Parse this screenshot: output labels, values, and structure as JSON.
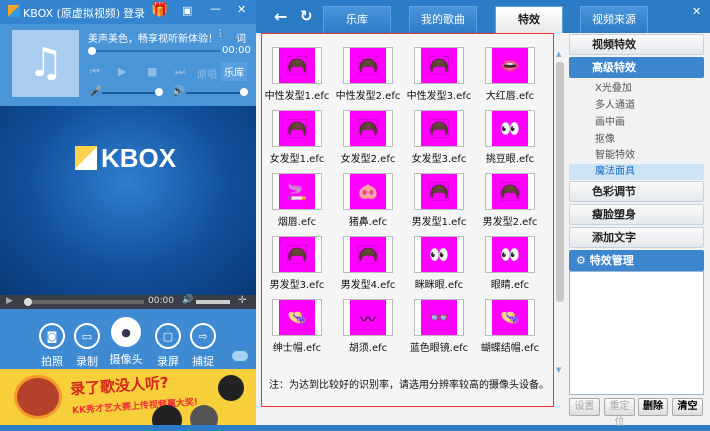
{
  "app": {
    "title": "KBOX (原虚拟视频)",
    "login": "登录",
    "logo": "KBOX"
  },
  "player": {
    "song_text": "美声美色，畅享视听新体验！",
    "lyrics_label": "词",
    "time": "00:00",
    "original_vocal": "原唱",
    "library": "乐库"
  },
  "video": {
    "time": "00:00"
  },
  "controls": [
    {
      "label": "拍照",
      "icon": "camera-icon"
    },
    {
      "label": "录制",
      "icon": "video-record-icon"
    },
    {
      "label": "摄像头",
      "icon": "webcam-icon"
    },
    {
      "label": "录屏",
      "icon": "screen-record-icon"
    },
    {
      "label": "捕捉",
      "icon": "capture-icon"
    }
  ],
  "banner": {
    "headline": "录了歌没人听?",
    "subline": "KK秀才艺大赛上传视频赢大奖!"
  },
  "tabs": [
    {
      "label": "乐库"
    },
    {
      "label": "我的歌曲"
    },
    {
      "label": "特效",
      "active": true
    },
    {
      "label": "视频来源"
    }
  ],
  "effects": [
    {
      "label": "中性发型1.efc",
      "icon": "hair"
    },
    {
      "label": "中性发型2.efc",
      "icon": "hair"
    },
    {
      "label": "中性发型3.efc",
      "icon": "hair"
    },
    {
      "label": "大红唇.efc",
      "icon": "lips"
    },
    {
      "label": "女发型1.efc",
      "icon": "hair"
    },
    {
      "label": "女发型2.efc",
      "icon": "hair"
    },
    {
      "label": "女发型3.efc",
      "icon": "hair"
    },
    {
      "label": "挑豆眼.efc",
      "icon": "eyes"
    },
    {
      "label": "烟唇.efc",
      "icon": "cigarette"
    },
    {
      "label": "猪鼻.efc",
      "icon": "pig-nose"
    },
    {
      "label": "男发型1.efc",
      "icon": "hair"
    },
    {
      "label": "男发型2.efc",
      "icon": "hair"
    },
    {
      "label": "男发型3.efc",
      "icon": "hair"
    },
    {
      "label": "男发型4.efc",
      "icon": "hair"
    },
    {
      "label": "眯眯眼.efc",
      "icon": "eyes"
    },
    {
      "label": "眼睛.efc",
      "icon": "eyes"
    },
    {
      "label": "绅士帽.efc",
      "icon": "hat"
    },
    {
      "label": "胡须.efc",
      "icon": "mustache"
    },
    {
      "label": "蓝色眼镜.efc",
      "icon": "glasses"
    },
    {
      "label": "蝴蝶结帽.efc",
      "icon": "hat"
    }
  ],
  "note": "注：为达到比较好的识别率，请选用分辨率较高的摄像头设备。",
  "sidebar": {
    "video_effects": "视频特效",
    "advanced_effects": "高级特效",
    "sub_items": [
      {
        "label": "X光叠加"
      },
      {
        "label": "多人通道"
      },
      {
        "label": "画中画"
      },
      {
        "label": "抠像"
      },
      {
        "label": "智能特效"
      },
      {
        "label": "魔法面具",
        "selected": true
      }
    ],
    "color_adjust": "色彩调节",
    "face_slim": "瘦脸塑身",
    "add_text": "添加文字",
    "manage": "特效管理"
  },
  "buttons": {
    "settings": "设置",
    "relocate": "重定位",
    "delete": "删除",
    "clear": "清空"
  },
  "colors": {
    "accent": "#3d85cc",
    "thumb_bg": "#ff00ff",
    "frame": "#e33333"
  }
}
